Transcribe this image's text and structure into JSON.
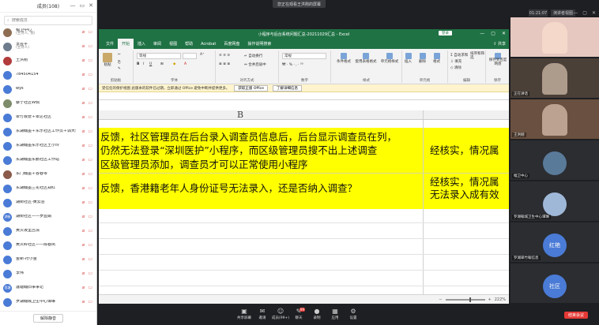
{
  "participants_panel": {
    "title": "成员(108)",
    "search_placeholder": "搜索成员",
    "mute_all_label": "解除静音",
    "members": [
      {
        "name": "幅卫中心",
        "sub": "(主持人, 我)",
        "color": "#8e6e53",
        "initial": ""
      },
      {
        "name": "李芸平",
        "sub": "(主持人)",
        "color": "#6d7b8d",
        "initial": ""
      },
      {
        "name": "王洪刚",
        "sub": "",
        "color": "#b23b3b",
        "initial": ""
      },
      {
        "name": "784504154",
        "sub": "",
        "color": "#4a7bd6",
        "initial": ""
      },
      {
        "name": "wys",
        "sub": "",
        "color": "#4a7bd6",
        "initial": ""
      },
      {
        "name": "蔡宁社区W佩",
        "sub": "",
        "color": "#7d8c6a",
        "initial": ""
      },
      {
        "name": "翠竹城管＋翠达社区",
        "sub": "",
        "color": "#4a7bd6",
        "initial": ""
      },
      {
        "name": "东湖翰墨＋东乐社区工作员＋郭大蓉",
        "sub": "",
        "color": "#4a7bd6",
        "initial": ""
      },
      {
        "name": "东湖翰墨东乐社区王小玲",
        "sub": "",
        "color": "#4a7bd6",
        "initial": ""
      },
      {
        "name": "东湖翰墨东鹏社区工作站",
        "sub": "",
        "color": "#4a7bd6",
        "initial": ""
      },
      {
        "name": "东门翰墨＋谷春琴",
        "sub": "",
        "color": "#8a5a4a",
        "initial": ""
      },
      {
        "name": "东湖翰墨兰花社区郑红",
        "sub": "",
        "color": "#4a7bd6",
        "initial": ""
      },
      {
        "name": "湖街社区-黄云芸",
        "sub": "",
        "color": "#4a7bd6",
        "initial": ""
      },
      {
        "name": "湖街社区——罗蓝娟",
        "sub": "",
        "color": "#4a7bd6",
        "initial": "湖街"
      },
      {
        "name": "黄贝坂里吕清",
        "sub": "",
        "color": "#4a7bd6",
        "initial": ""
      },
      {
        "name": "黄贝岭社区——陈春凤",
        "sub": "",
        "color": "#4a7bd6",
        "initial": ""
      },
      {
        "name": "金新-符小金",
        "sub": "",
        "color": "#4a7bd6",
        "initial": ""
      },
      {
        "name": "李伟",
        "sub": "",
        "color": "#4a7bd6",
        "initial": ""
      },
      {
        "name": "莲塘翰旧事事记",
        "sub": "",
        "color": "#4a7bd6",
        "initial": "莲塘"
      },
      {
        "name": "罗湖翰城卫生中心谭琳",
        "sub": "",
        "color": "#4a7bd6",
        "initial": ""
      },
      {
        "name": "罗湖社区",
        "sub": "",
        "color": "#4a7bd6",
        "initial": ""
      }
    ]
  },
  "meeting": {
    "share_banner": "您正在观看王洪刚的屏幕",
    "timer": "01:21:07",
    "view_label": "演讲者视图",
    "tiles": [
      {
        "label": "",
        "kind": "photo",
        "color": "#e6c8c0",
        "text": ""
      },
      {
        "label": "正在讲话",
        "kind": "photo",
        "color": "#4a4038",
        "text": ""
      },
      {
        "label": "王洪刚",
        "kind": "photo",
        "color": "#6a5040",
        "text": ""
      },
      {
        "label": "幅卫中心",
        "kind": "avatar",
        "color": "#5a7a9a",
        "text": ""
      },
      {
        "label": "罗湖翰城卫生中心谭琳",
        "kind": "avatar",
        "color": "#a0b8d8",
        "text": ""
      },
      {
        "label": "罗湖翠竹翰信息",
        "kind": "avatar",
        "color": "#4a7bd6",
        "text": "红艳"
      },
      {
        "label": "",
        "kind": "avatar",
        "color": "#4a7bd6",
        "text": "社区"
      }
    ],
    "toolbar": [
      {
        "label": "共享屏幕",
        "glyph": "▣"
      },
      {
        "label": "邀请",
        "glyph": "✉"
      },
      {
        "label": "成员(99+)",
        "glyph": "☺"
      },
      {
        "label": "聊天",
        "glyph": "✎",
        "badge": "99"
      },
      {
        "label": "录制",
        "glyph": "●"
      },
      {
        "label": "应用",
        "glyph": "▦"
      },
      {
        "label": "设置",
        "glyph": "⚙"
      }
    ],
    "end_label": "结束会议"
  },
  "excel": {
    "title": "小程序与后台系统问题汇总-20211029汇总 - Excel",
    "login_label": "登录",
    "share_label": "共享",
    "tabs": [
      "文件",
      "开始",
      "插入",
      "审阅",
      "视图",
      "帮助",
      "Acrobat",
      "百度网盘",
      "操作说明搜索"
    ],
    "active_tab": "开始",
    "ribbon": {
      "paste": "粘贴",
      "clipboard": "剪贴板",
      "font_name": "等线",
      "font_label": "字体",
      "wrap": "自动换行",
      "merge": "合并后居中",
      "align_label": "对齐方式",
      "number_format": "常规",
      "number_label": "数字",
      "cond_format": "条件格式",
      "table_format": "套用表格格式",
      "cell_style": "单元格样式",
      "style_label": "样式",
      "insert": "插入",
      "delete": "删除",
      "format": "格式",
      "cells_label": "单元格",
      "autosum": "自动求和",
      "fill": "填充",
      "clear": "清除",
      "sort": "排序和筛选",
      "find": "查找和选择",
      "edit_label": "编辑",
      "save_baidu": "保存到百度网盘",
      "save_label": "保存"
    },
    "warning": "受信任的保护视图 此版本的软件已过期，立即通过 Office 避免中断并提供更多。",
    "warning_btn1": "获取正版 Office",
    "warning_btn2": "了解详细信息",
    "column_header": "B",
    "rows": {
      "r1_line1": "反馈，社区管理员在后台录入调查员信息后，后台显示调查员在列，",
      "r1_line2": "仍然无法登录“深圳医护”小程序，而区级管理员搜不出上述调查",
      "r1_line3": "区级管理员添加，调查员才可以正常使用小程序",
      "r1_right": "经核实，情况属",
      "r2_line1": "反馈，香港籍老年人身份证号无法录入，还是否纳入调查？",
      "r2_right1": "经核实，情况属",
      "r2_right2": "无法录入成有效"
    },
    "zoom": "222%"
  }
}
